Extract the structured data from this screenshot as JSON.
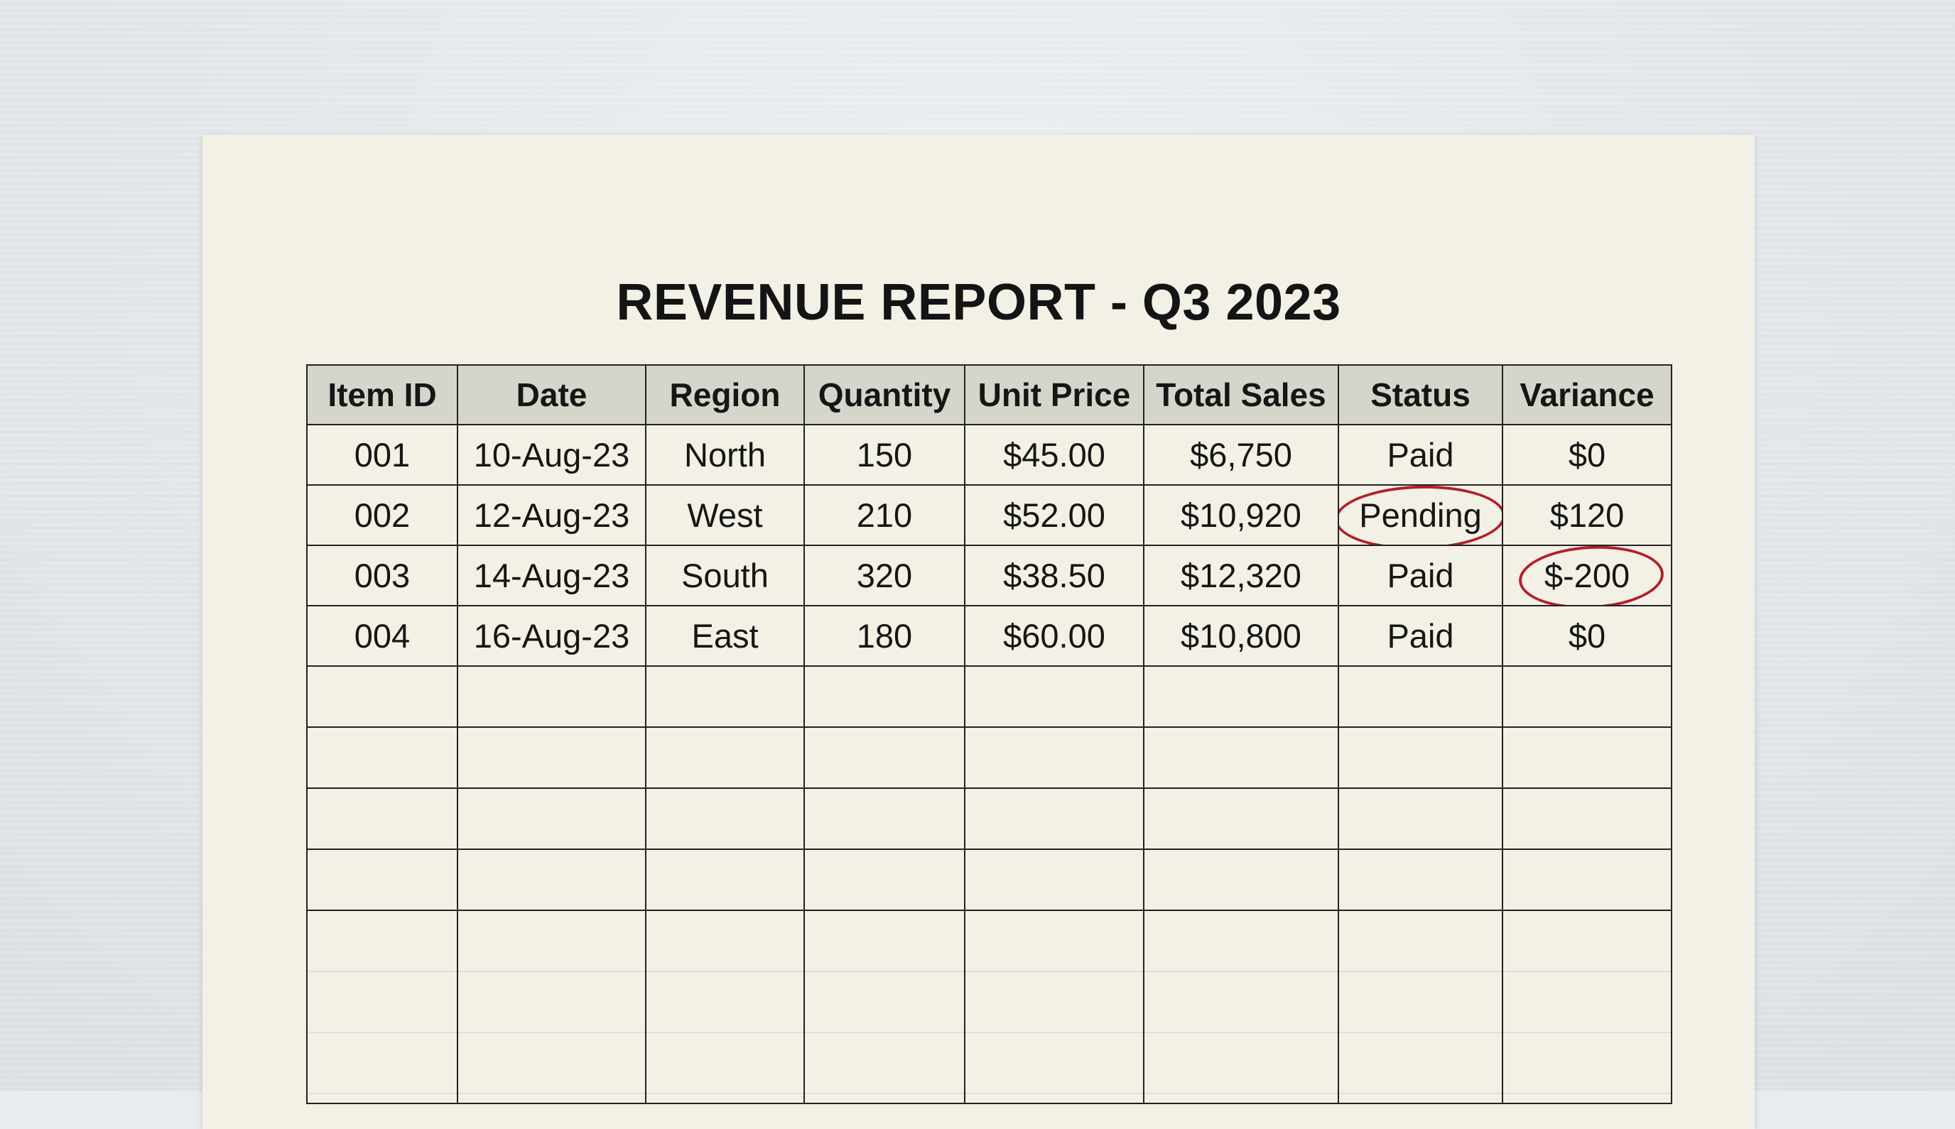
{
  "document": {
    "title": "REVENUE REPORT - Q3 2023"
  },
  "table": {
    "headers": [
      "Item ID",
      "Date",
      "Region",
      "Quantity",
      "Unit Price",
      "Total Sales",
      "Status",
      "Variance"
    ],
    "rows": [
      [
        "001",
        "10-Aug-23",
        "North",
        "150",
        "$45.00",
        "$6,750",
        "Paid",
        "$0"
      ],
      [
        "002",
        "12-Aug-23",
        "West",
        "210",
        "$52.00",
        "$10,920",
        "Pending",
        "$120"
      ],
      [
        "003",
        "14-Aug-23",
        "South",
        "320",
        "$38.50",
        "$12,320",
        "Paid",
        "$-200"
      ],
      [
        "004",
        "16-Aug-23",
        "East",
        "180",
        "$60.00",
        "$10,800",
        "Paid",
        "$0"
      ]
    ],
    "empty_row_count": 5
  },
  "annotations": {
    "circled_cells": [
      "Pending",
      "$-200"
    ],
    "mark_color": "#b3202a"
  },
  "colors": {
    "paper": "#f3f1e6",
    "header_fill": "#d6d5cc",
    "background": "#e6e9ed"
  }
}
